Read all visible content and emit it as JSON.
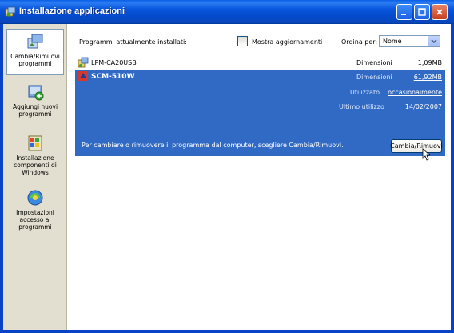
{
  "window": {
    "title": "Installazione applicazioni",
    "title_icon": "add-remove-programs-icon",
    "controls": [
      "minimize-icon",
      "maximize-icon",
      "close-icon"
    ]
  },
  "sidebar": {
    "items": [
      {
        "label": "Cambia/Rimuovi programmi",
        "icon": "change-remove-programs-icon",
        "selected": true
      },
      {
        "label": "Aggiungi nuovi programmi",
        "icon": "add-programs-icon",
        "selected": false
      },
      {
        "label": "Installazione componenti di Windows",
        "icon": "windows-components-icon",
        "selected": false
      },
      {
        "label": "Impostazioni accesso ai programmi",
        "icon": "program-access-icon",
        "selected": false
      }
    ]
  },
  "header": {
    "installed_label": "Programmi attualmente installati:",
    "show_updates_label": "Mostra aggiornamenti",
    "show_updates_checked": false,
    "sort_label": "Ordina per:",
    "sort_value": "Nome"
  },
  "programs": [
    {
      "name": "LPM-CA20USB",
      "size_label": "Dimensioni",
      "size": "1,09MB",
      "icon": "installer-icon"
    },
    {
      "name": "SCM-510W",
      "selected": true,
      "icon": "scm-program-icon",
      "size_label": "Dimensioni",
      "size": "61,92MB",
      "used_label": "Utilizzato",
      "used_value": "occasionalmente",
      "last_used_label": "Ultimo utilizzo",
      "last_used_value": "14/02/2007",
      "description": "Per cambiare o rimuovere il programma dal computer, scegliere Cambia/Rimuovi.",
      "button_label": "Cambia/Rimuovi"
    }
  ],
  "colors": {
    "titlebar": "#0855dd",
    "selection": "#316ac5",
    "sidebar_bg": "#e2dfd0"
  }
}
